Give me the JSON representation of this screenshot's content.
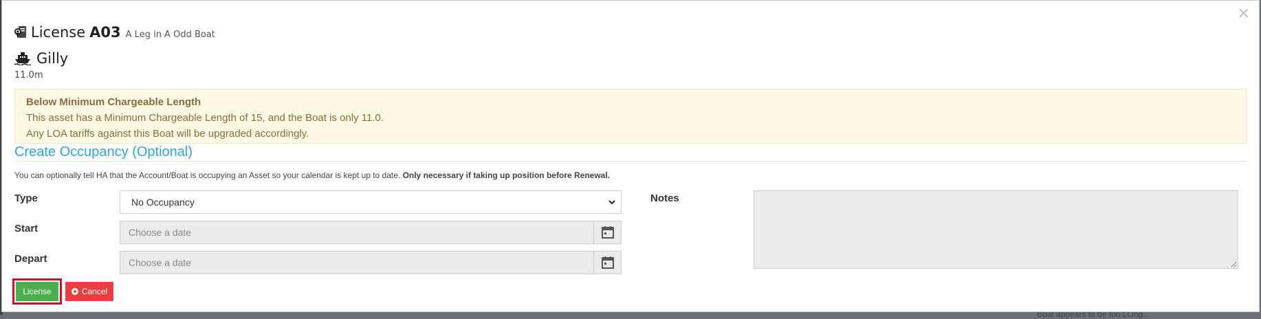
{
  "modal": {
    "close_glyph": "×",
    "title": "License",
    "license_code": "A03",
    "title_sub": "A Leg in A Odd Boat",
    "boat_name": "Gilly",
    "boat_length": "11.0m"
  },
  "warning": {
    "title": "Below Minimum Chargeable Length",
    "line1": "This asset has a Minimum Chargeable Length of 15, and the Boat is only 11.0.",
    "line2": "Any LOA tariffs against this Boat will be upgraded accordingly."
  },
  "occupancy": {
    "heading": "Create Occupancy (Optional)",
    "info_text": "You can optionally tell HA that the Account/Boat is occupying an Asset so your calendar is kept up to date. ",
    "info_bold": "Only necessary if taking up position before Renewal."
  },
  "form": {
    "type_label": "Type",
    "type_value": "No Occupancy",
    "start_label": "Start",
    "start_placeholder": "Choose a date",
    "depart_label": "Depart",
    "depart_placeholder": "Choose a date",
    "notes_label": "Notes"
  },
  "buttons": {
    "license_label": "License",
    "cancel_label": "Cancel"
  },
  "background": {
    "peek_text": "Boat appears to be too LOng..."
  },
  "colors": {
    "accent_heading": "#2fa6dc",
    "warning_bg": "#fcf8e3",
    "warning_text": "#8a6d3b",
    "license_button": "#4cae4c",
    "cancel_button": "#e74040",
    "highlight_border": "#c8102e"
  },
  "icons": {
    "title_icon": "pin-document-icon",
    "boat_icon": "ship-icon",
    "calendar_icon": "calendar-icon",
    "chevron_icon": "chevron-down-icon",
    "cancel_icon": "radio-circle-icon"
  }
}
